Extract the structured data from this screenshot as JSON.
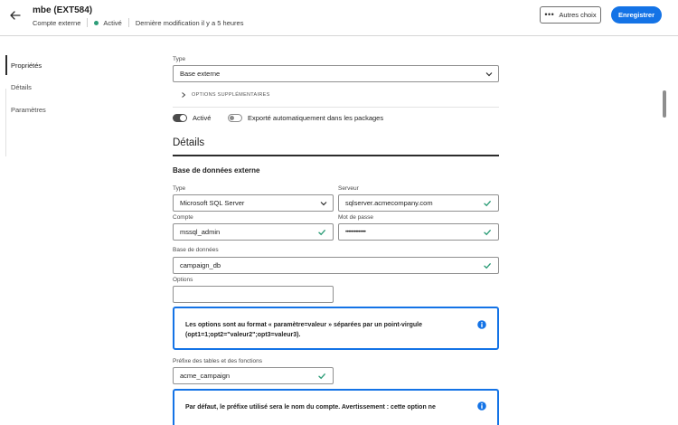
{
  "header": {
    "title": "mbe (EXT584)",
    "type_label": "Compte externe",
    "status": "Activé",
    "last_modified": "Dernière modification il y a 5 heures",
    "more_button": "Autres choix",
    "save_button": "Enregistrer"
  },
  "sidebar": {
    "items": [
      {
        "label": "Propriétés",
        "active": true
      },
      {
        "label": "Détails",
        "active": false
      },
      {
        "label": "Paramètres",
        "active": false
      }
    ]
  },
  "properties": {
    "type_label": "Type",
    "type_value": "Base externe",
    "more_options_label": "OPTIONS SUPPLÉMENTAIRES",
    "toggle_active_label": "Activé",
    "toggle_active_on": true,
    "toggle_export_label": "Exporté automatiquement dans les packages",
    "toggle_export_on": false
  },
  "details": {
    "section_title": "Détails",
    "subsection_title": "Base de données externe",
    "type_label": "Type",
    "type_value": "Microsoft SQL Server",
    "server_label": "Serveur",
    "server_value": "sqlserver.acmecompany.com",
    "account_label": "Compte",
    "account_value": "mssql_admin",
    "password_label": "Mot de passe",
    "password_value": "••••••••••••••",
    "database_label": "Base de données",
    "database_value": "campaign_db",
    "options_label": "Options",
    "options_value": "",
    "options_info_line1": "Les options sont au format « paramètre=valeur » séparées par un point-virgule",
    "options_info_line2": "(opt1=1;opt2=\"valeur2\";opt3=valeur3).",
    "prefix_label": "Préfixe des tables et des fonctions",
    "prefix_value": "acme_campaign",
    "prefix_info_line1": "Par défaut, le préfixe utilisé sera le nom du compte. Avertissement : cette option ne"
  },
  "colors": {
    "accent": "#1473e6",
    "success": "#2d9d78"
  }
}
